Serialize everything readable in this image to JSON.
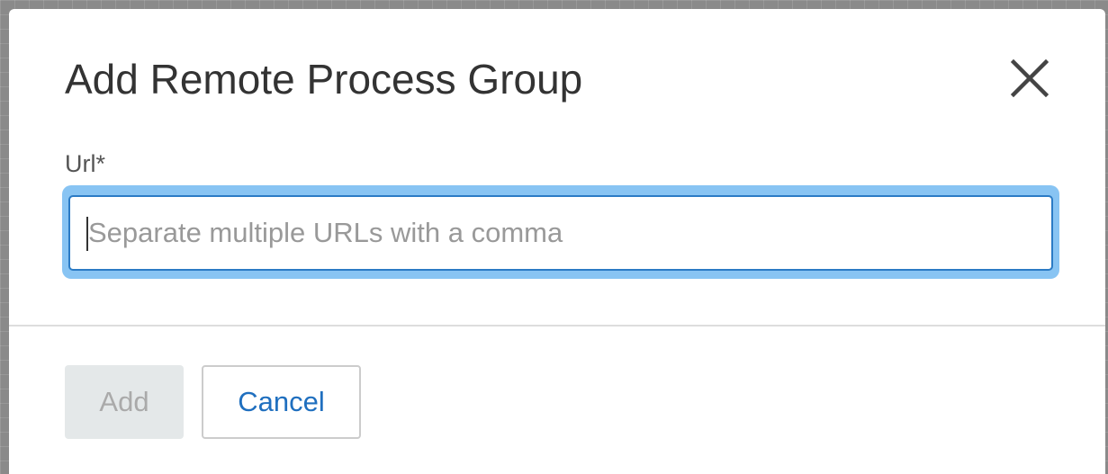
{
  "dialog": {
    "title": "Add Remote Process Group",
    "close_icon": "close-icon"
  },
  "form": {
    "url_label": "Url*",
    "url_value": "",
    "url_placeholder": "Separate multiple URLs with a comma"
  },
  "footer": {
    "add_label": "Add",
    "add_disabled": true,
    "cancel_label": "Cancel"
  },
  "colors": {
    "focus_ring": "#88c4f3",
    "focus_border": "#2b7bc5",
    "link_blue": "#1f6fbf",
    "disabled_bg": "#e4e8e9"
  }
}
